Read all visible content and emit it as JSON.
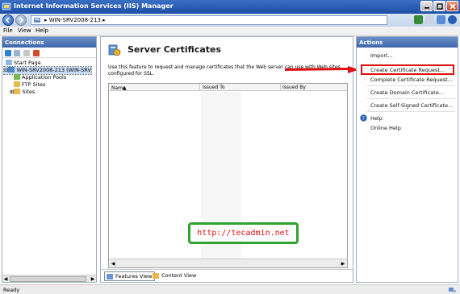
{
  "window": {
    "title": "Internet Information Services (IIS) Manager"
  },
  "address": {
    "crumb": "WIN-SRV2008-213",
    "sep": "▸"
  },
  "menu": {
    "file": "File",
    "view": "View",
    "help": "Help"
  },
  "connections": {
    "header": "Connections",
    "tree": {
      "start_page": "Start Page",
      "server": "WIN-SRV2008-213 (WIN-SRV",
      "app_pools": "Application Pools",
      "ftp_sites": "FTP Sites",
      "sites": "Sites"
    }
  },
  "main": {
    "title": "Server Certificates",
    "description": "Use this feature to request and manage certificates that the Web server can use with Web sites configured for SSL.",
    "columns": {
      "name": "Name",
      "sort": "▲",
      "issued_to": "Issued To",
      "issued_by": "Issued By"
    },
    "watermark": "http://tecadmin.net",
    "tabs": {
      "features": "Features View",
      "content": "Content View"
    }
  },
  "actions": {
    "header": "Actions",
    "items": {
      "import": "Import...",
      "create_request": "Create Certificate Request...",
      "complete_request": "Complete Certificate Request...",
      "create_domain": "Create Domain Certificate...",
      "create_self_signed": "Create Self-Signed Certificate...",
      "help": "Help",
      "online_help": "Online Help"
    }
  },
  "status": {
    "text": "Ready"
  },
  "colors": {
    "accent": "#3e66aa",
    "highlight": "#e01010",
    "watermark_border": "#2fa32f"
  }
}
